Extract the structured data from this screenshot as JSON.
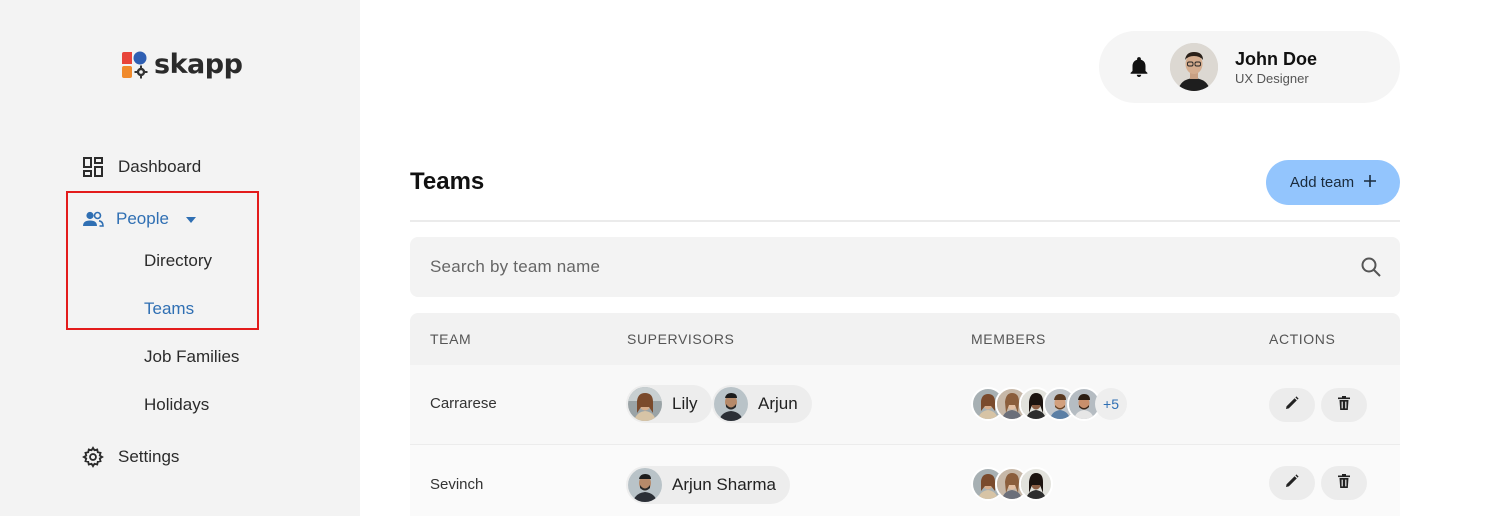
{
  "app": {
    "logo_text": "skapp"
  },
  "sidebar": {
    "items": [
      {
        "label": "Dashboard",
        "icon": "dashboard-icon"
      },
      {
        "label": "People",
        "icon": "people-icon",
        "expanded": true
      },
      {
        "label": "Directory"
      },
      {
        "label": "Teams",
        "active": true
      },
      {
        "label": "Job Families"
      },
      {
        "label": "Holidays"
      },
      {
        "label": "Settings",
        "icon": "gear-icon"
      }
    ]
  },
  "header": {
    "user": {
      "name": "John Doe",
      "role": "UX Designer"
    }
  },
  "page": {
    "title": "Teams",
    "add_button_label": "Add team",
    "search_placeholder": "Search by team name"
  },
  "table": {
    "columns": [
      "TEAM",
      "SUPERVISORS",
      "MEMBERS",
      "ACTIONS"
    ],
    "rows": [
      {
        "team": "Carrarese",
        "supervisors": [
          "Lily",
          "Arjun"
        ],
        "members_extra": "+5"
      },
      {
        "team": "Sevinch",
        "supervisors": [
          "Arjun Sharma"
        ],
        "members_extra": ""
      }
    ]
  },
  "colors": {
    "accent": "#2f6fb3",
    "add_button": "#93c5fd",
    "highlight": "#e31b1b",
    "sidebar_bg": "#f3f3f3"
  }
}
